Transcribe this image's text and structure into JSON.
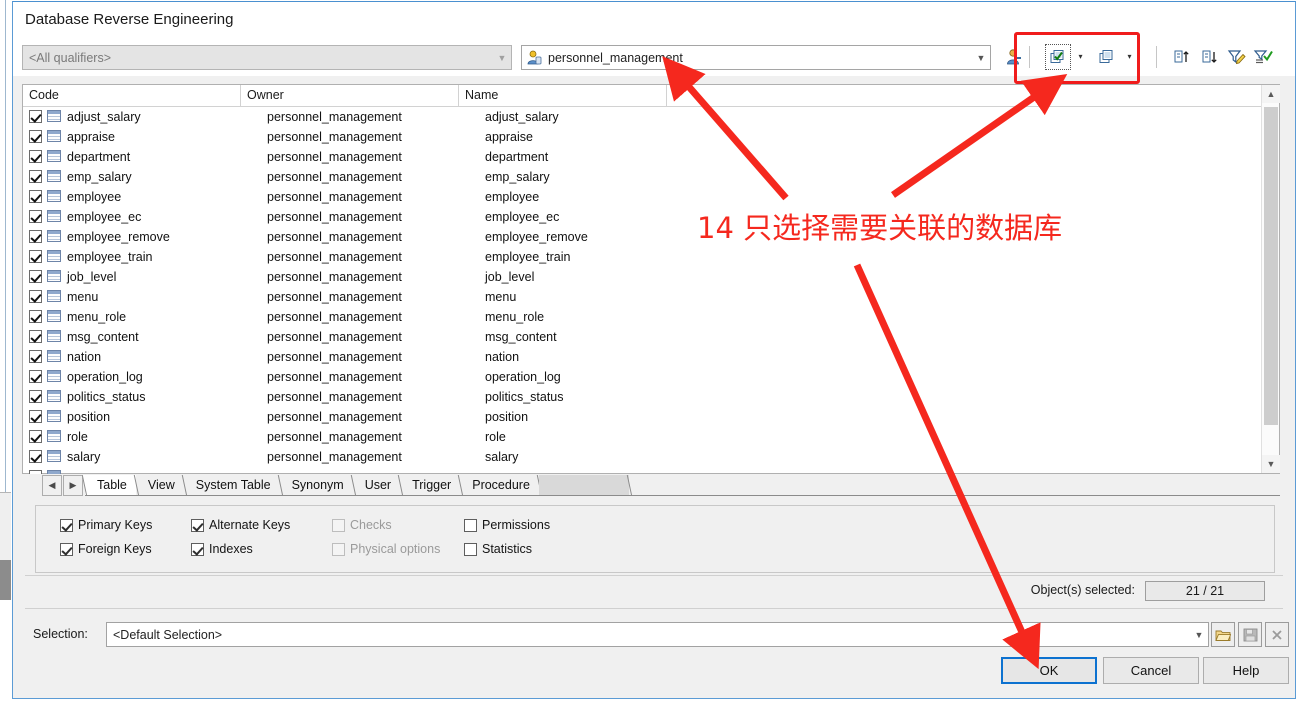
{
  "window": {
    "title": "Database Reverse Engineering"
  },
  "toolbar": {
    "qualifier": {
      "value": "<All qualifiers>",
      "enabled": false
    },
    "database": {
      "value": "personnel_management",
      "icon": "database-user-icon"
    },
    "buttons": [
      {
        "name": "user-properties-icon",
        "label": ""
      },
      {
        "name": "select-all-copies-icon",
        "label": ""
      },
      {
        "name": "select-all-dropdown-arrow",
        "label": "▾"
      },
      {
        "name": "deselect-all-copies-icon",
        "label": ""
      },
      {
        "name": "deselect-all-dropdown-arrow",
        "label": "▾"
      },
      {
        "name": "sort-ascending-icon",
        "label": ""
      },
      {
        "name": "sort-descending-icon",
        "label": ""
      },
      {
        "name": "edit-filter-icon",
        "label": ""
      },
      {
        "name": "apply-filter-icon",
        "label": ""
      }
    ]
  },
  "list": {
    "columns": [
      "Code",
      "Owner",
      "Name"
    ],
    "rows": [
      {
        "checked": true,
        "code": "adjust_salary",
        "owner": "personnel_management",
        "name": "adjust_salary"
      },
      {
        "checked": true,
        "code": "appraise",
        "owner": "personnel_management",
        "name": "appraise"
      },
      {
        "checked": true,
        "code": "department",
        "owner": "personnel_management",
        "name": "department"
      },
      {
        "checked": true,
        "code": "emp_salary",
        "owner": "personnel_management",
        "name": "emp_salary"
      },
      {
        "checked": true,
        "code": "employee",
        "owner": "personnel_management",
        "name": "employee"
      },
      {
        "checked": true,
        "code": "employee_ec",
        "owner": "personnel_management",
        "name": "employee_ec"
      },
      {
        "checked": true,
        "code": "employee_remove",
        "owner": "personnel_management",
        "name": "employee_remove"
      },
      {
        "checked": true,
        "code": "employee_train",
        "owner": "personnel_management",
        "name": "employee_train"
      },
      {
        "checked": true,
        "code": "job_level",
        "owner": "personnel_management",
        "name": "job_level"
      },
      {
        "checked": true,
        "code": "menu",
        "owner": "personnel_management",
        "name": "menu"
      },
      {
        "checked": true,
        "code": "menu_role",
        "owner": "personnel_management",
        "name": "menu_role"
      },
      {
        "checked": true,
        "code": "msg_content",
        "owner": "personnel_management",
        "name": "msg_content"
      },
      {
        "checked": true,
        "code": "nation",
        "owner": "personnel_management",
        "name": "nation"
      },
      {
        "checked": true,
        "code": "operation_log",
        "owner": "personnel_management",
        "name": "operation_log"
      },
      {
        "checked": true,
        "code": "politics_status",
        "owner": "personnel_management",
        "name": "politics_status"
      },
      {
        "checked": true,
        "code": "position",
        "owner": "personnel_management",
        "name": "position"
      },
      {
        "checked": true,
        "code": "role",
        "owner": "personnel_management",
        "name": "role"
      },
      {
        "checked": true,
        "code": "salary",
        "owner": "personnel_management",
        "name": "salary"
      }
    ]
  },
  "tabs": {
    "prev_label": "◀",
    "next_label": "▶",
    "items": [
      {
        "label": "Table",
        "active": true
      },
      {
        "label": "View",
        "active": false
      },
      {
        "label": "System Table",
        "active": false
      },
      {
        "label": "Synonym",
        "active": false
      },
      {
        "label": "User",
        "active": false
      },
      {
        "label": "Trigger",
        "active": false
      },
      {
        "label": "Procedure",
        "active": false
      }
    ]
  },
  "options": [
    {
      "label": "Primary Keys",
      "checked": true,
      "enabled": true,
      "col": 0,
      "row": 0
    },
    {
      "label": "Foreign Keys",
      "checked": true,
      "enabled": true,
      "col": 0,
      "row": 1
    },
    {
      "label": "Alternate Keys",
      "checked": true,
      "enabled": true,
      "col": 1,
      "row": 0
    },
    {
      "label": "Indexes",
      "checked": true,
      "enabled": true,
      "col": 1,
      "row": 1
    },
    {
      "label": "Checks",
      "checked": false,
      "enabled": false,
      "col": 2,
      "row": 0
    },
    {
      "label": "Physical options",
      "checked": false,
      "enabled": false,
      "col": 2,
      "row": 1
    },
    {
      "label": "Permissions",
      "checked": false,
      "enabled": true,
      "col": 3,
      "row": 0
    },
    {
      "label": "Statistics",
      "checked": false,
      "enabled": true,
      "col": 3,
      "row": 1
    }
  ],
  "status": {
    "objects_selected_label": "Object(s) selected:",
    "objects_selected_value": "21 / 21"
  },
  "selection": {
    "label": "Selection:",
    "value": "<Default Selection>",
    "buttons": [
      {
        "name": "open-folder-icon"
      },
      {
        "name": "save-icon"
      },
      {
        "name": "delete-icon"
      }
    ]
  },
  "footer": {
    "ok_label": "OK",
    "cancel_label": "Cancel",
    "help_label": "Help"
  },
  "annotation": {
    "text": "14 只选择需要关联的数据库",
    "color": "#f5281e"
  }
}
